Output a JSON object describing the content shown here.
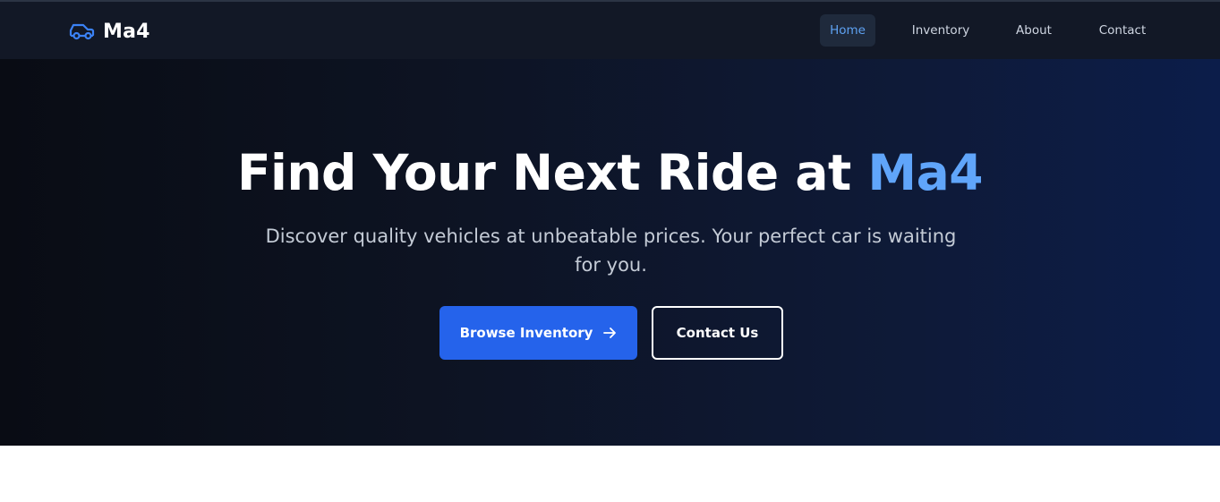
{
  "brand": {
    "name": "Ma4",
    "icon": "car-icon",
    "icon_color": "#3b82f6"
  },
  "nav": {
    "items": [
      {
        "label": "Home",
        "active": true
      },
      {
        "label": "Inventory",
        "active": false
      },
      {
        "label": "About",
        "active": false
      },
      {
        "label": "Contact",
        "active": false
      }
    ]
  },
  "hero": {
    "title_main": "Find Your Next Ride at",
    "title_accent": "Ma4",
    "subtitle": "Discover quality vehicles at unbeatable prices. Your perfect car is waiting for you.",
    "primary_button": "Browse Inventory",
    "primary_button_icon": "arrow-right-icon",
    "secondary_button": "Contact Us"
  },
  "colors": {
    "accent": "#60a5fa",
    "primary_button": "#2563eb",
    "nav_bg": "#121826",
    "active_nav_text": "#5ea2f2"
  }
}
